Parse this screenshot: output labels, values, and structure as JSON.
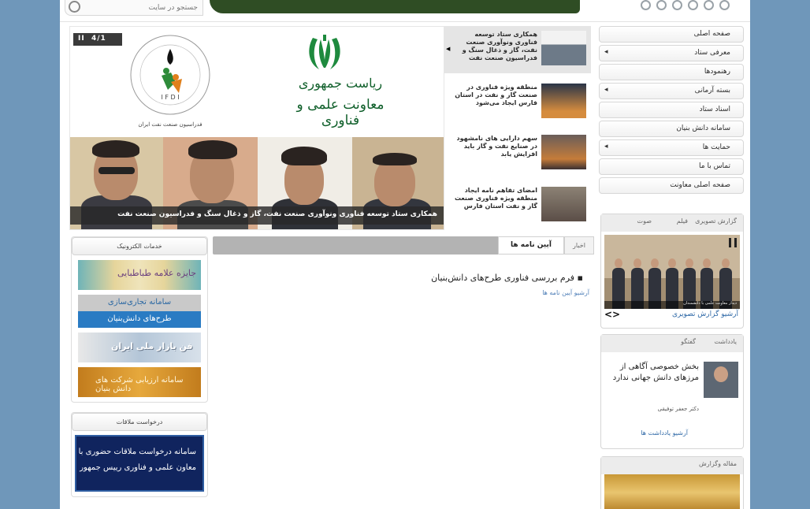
{
  "search": {
    "placeholder": "جستجو در سایت"
  },
  "topbar": {
    "text": ""
  },
  "menu": {
    "items": [
      {
        "label": "صفحه اصلی",
        "arrow": false
      },
      {
        "label": "معرفی ستاد",
        "arrow": true
      },
      {
        "label": "رهنمودها",
        "arrow": false
      },
      {
        "label": "بسته آرمانی",
        "arrow": true
      },
      {
        "label": "اسناد ستاد",
        "arrow": false
      },
      {
        "label": "سامانه دانش بنیان",
        "arrow": false
      },
      {
        "label": "حمایت ها",
        "arrow": true
      },
      {
        "label": "تماس با ما",
        "arrow": false
      },
      {
        "label": "صفحه اصلی معاونت",
        "arrow": false
      }
    ],
    "arrow_glyph": "◂"
  },
  "slider": {
    "counter": "4/1",
    "pause": "II",
    "logo_letters": "I F D I",
    "logo_ring": "IRAN FEDERATION OF OIL INDUSTRY",
    "logo_sub": "فدراسیون صنعت نفت ایران",
    "pres_line1": "ریاست جمهوری",
    "pres_line2": "معاونت علمی و فناوری",
    "caption": "همکاری ستاد توسعه فناوری ونوآوری صنعت نفت، گاز و ذغال سنگ و فدراسیون صنعت نفت"
  },
  "news": [
    {
      "text": "همکاری ستاد توسعه فناوری ونوآوری صنعت نفت، گاز و ذغال سنگ و فدراسیون صنعت نفت"
    },
    {
      "text": "منطقه ویژه فناوری در صنعت گاز و نفت در استان فارس ایجاد می‌شود"
    },
    {
      "text": "سهم دارایی های نامشهود در صنایع نفت و گاز باید افزایش یابد"
    },
    {
      "text": "امضای تفاهم نامه ایجاد منطقه ویژه فناوری صنعت گاز و نفت استان فارس"
    }
  ],
  "left": {
    "eservices_title": "خدمات الکترونیک",
    "banner1": "جایزه علامه طباطبایی",
    "banner2_top": "سامانه تجاری‌سازی",
    "banner2_bottom": "طرح‌های دانش‌بنیان",
    "banner3": "فن بازار ملی ایران",
    "banner4": "سامانه ارزیابی شرکت های دانش بنیان",
    "visit_title": "درخواست ملاقات",
    "visit_line1": "سامانه درخواست ملاقات حضوری با",
    "visit_line2": "معاون علمی و فناوری رییس جمهور"
  },
  "center": {
    "tab_news": "اخبار",
    "tab_regs": "آیین نامه ها",
    "bullet": "فرم بررسی فناوری طرح‌های دانش‌بنیان",
    "archive": "آرشیو آیین نامه ها"
  },
  "gallery": {
    "tab_photo": "گزارش تصویری",
    "tab_film": "فیلم",
    "tab_audio": "صوت",
    "caption": "دیدار معاونت علمی با دانشمندان",
    "archive": "آرشیو گزارش تصویری",
    "arrows": "<>"
  },
  "notes": {
    "tab_note": "یادداشت",
    "tab_dialog": "گفتگو",
    "title": "بخش خصوصی آگاهی از مرزهای دانش جهانی ندارد",
    "author": "دکتر جعفر توفیقی",
    "archive": "آرشیو یادداشت ها"
  },
  "article": {
    "tab": "مقاله وگزارش"
  }
}
